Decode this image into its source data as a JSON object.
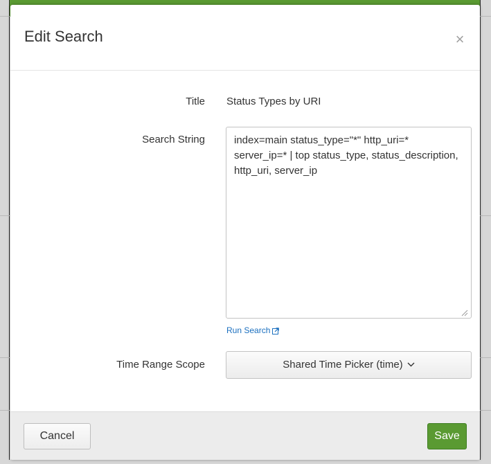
{
  "dialog": {
    "title": "Edit Search",
    "close_symbol": "×"
  },
  "form": {
    "title_label": "Title",
    "title_value": "Status Types by URI",
    "search_label": "Search String",
    "search_value": "index=main status_type=\"*\" http_uri=* server_ip=* | top status_type, status_description, http_uri, server_ip",
    "run_search_label": "Run Search",
    "time_range_label": "Time Range Scope",
    "time_range_value": "Shared Time Picker (time)"
  },
  "footer": {
    "cancel_label": "Cancel",
    "save_label": "Save"
  },
  "colors": {
    "save_green": "#5a9a32",
    "link_blue": "#1a6fbf"
  },
  "icons": {
    "close": "close-icon",
    "external": "external-link-icon",
    "chevron": "chevron-down-icon"
  }
}
